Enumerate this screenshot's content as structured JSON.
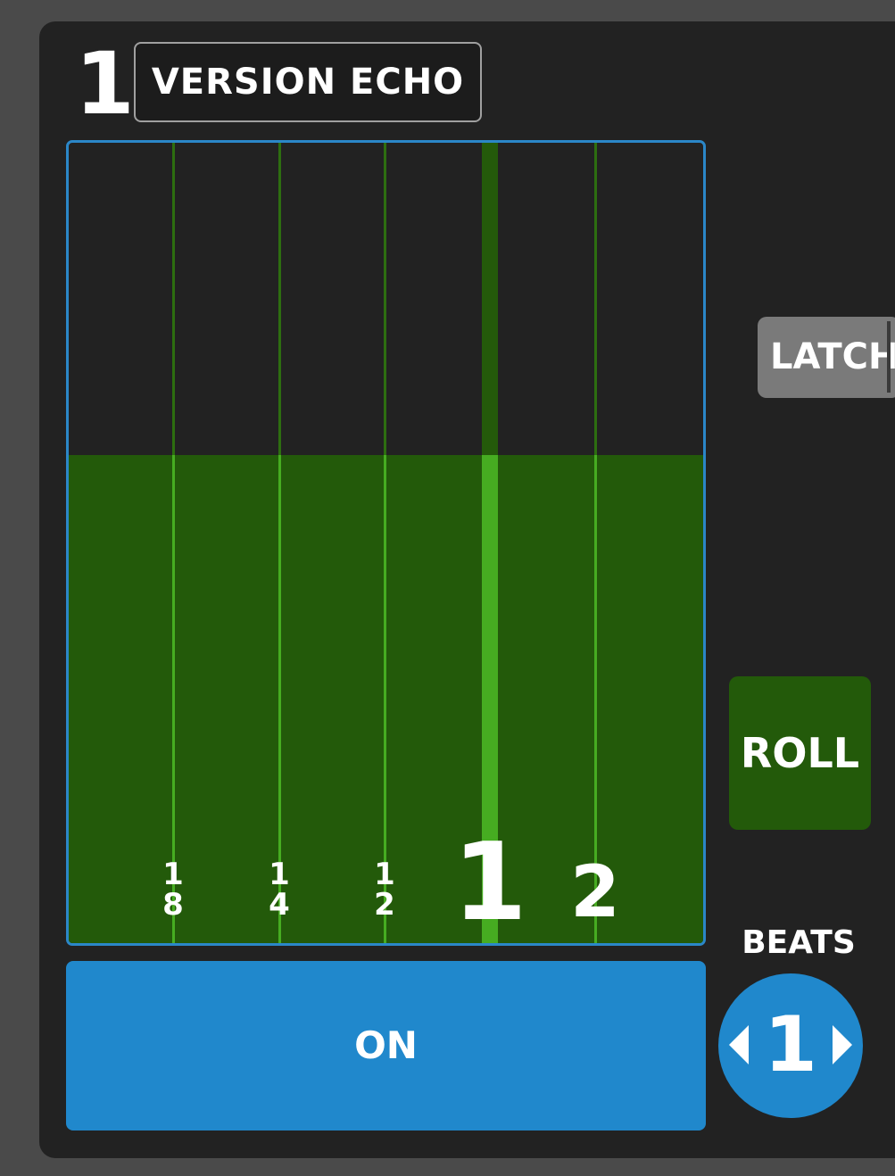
{
  "deck": {
    "number": "1"
  },
  "effect": {
    "name": "VERSION ECHO"
  },
  "xy_pad": {
    "level_fraction": 0.61,
    "active_division": "1",
    "divisions": [
      {
        "numerator": "1",
        "denominator": "8",
        "label": "",
        "position": 0.165,
        "active": false
      },
      {
        "numerator": "1",
        "denominator": "4",
        "label": "",
        "position": 0.332,
        "active": false
      },
      {
        "numerator": "1",
        "denominator": "2",
        "label": "",
        "position": 0.498,
        "active": false
      },
      {
        "numerator": "",
        "denominator": "",
        "label": "1",
        "position": 0.664,
        "active": true
      },
      {
        "numerator": "",
        "denominator": "",
        "label": "2",
        "position": 0.83,
        "active": false
      }
    ],
    "colors": {
      "fill": "#235a0a",
      "line_dim": "#2d6e10",
      "line_bright": "#46ac21",
      "active_upper": "#245a0a",
      "border": "#2b87c8"
    }
  },
  "buttons": {
    "on_label": "ON",
    "latch_label": "LATCH",
    "roll_label": "ROLL"
  },
  "beats": {
    "label": "BEATS",
    "value": "1"
  }
}
